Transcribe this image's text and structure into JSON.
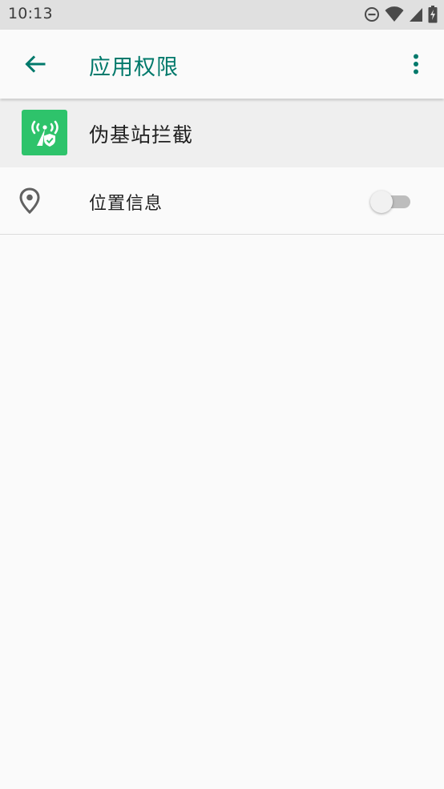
{
  "status_bar": {
    "time": "10:13",
    "icons": [
      "do-not-disturb-icon",
      "wifi-icon",
      "cell-signal-icon",
      "battery-charging-icon"
    ]
  },
  "app_bar": {
    "title": "应用权限",
    "back_icon": "arrow-back-icon",
    "menu_icon": "more-vert-icon",
    "accent_color": "#00796b"
  },
  "app_header": {
    "app_name": "伪基站拦截",
    "icon": "cell-tower-shield-icon",
    "icon_color": "#2ec36b"
  },
  "permissions": [
    {
      "label": "位置信息",
      "icon": "location-pin-icon",
      "enabled": false
    }
  ]
}
